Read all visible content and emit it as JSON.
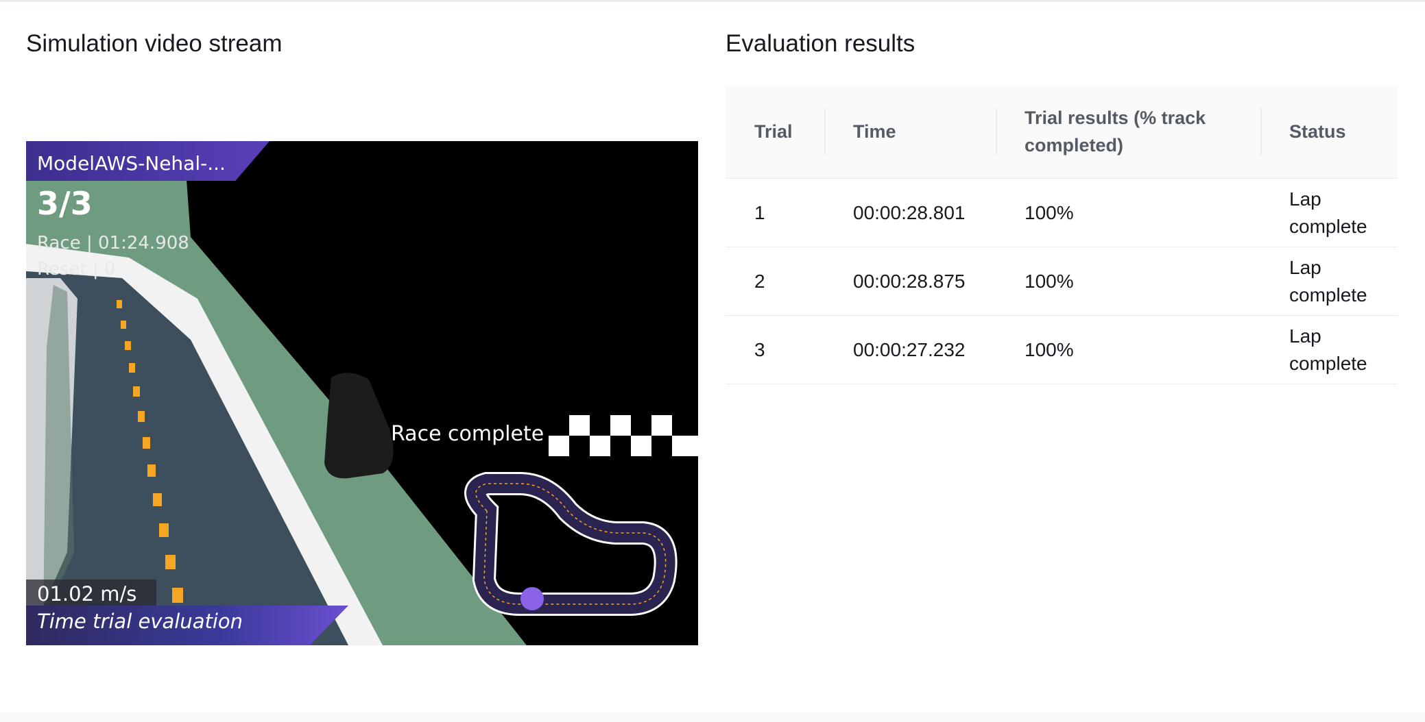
{
  "simulation": {
    "title": "Simulation video stream",
    "overlay": {
      "model_name": "ModelAWS-Nehal-...",
      "lap_count": "3/3",
      "race_time": "Race | 01:24.908",
      "reset_count": "Reset | 0",
      "speed": "01.02 m/s",
      "mode": "Time trial evaluation",
      "race_status": "Race complete"
    }
  },
  "evaluation": {
    "title": "Evaluation results",
    "columns": [
      "Trial",
      "Time",
      "Trial results (% track completed)",
      "Status"
    ],
    "rows": [
      [
        "1",
        "00:00:28.801",
        "100%",
        "Lap complete"
      ],
      [
        "2",
        "00:00:28.875",
        "100%",
        "Lap complete"
      ],
      [
        "3",
        "00:00:27.232",
        "100%",
        "Lap complete"
      ]
    ]
  },
  "colors": {
    "banner_purple": "#5a3fb8",
    "track_green": "#6b9a7c",
    "center_line": "#f5a623"
  }
}
